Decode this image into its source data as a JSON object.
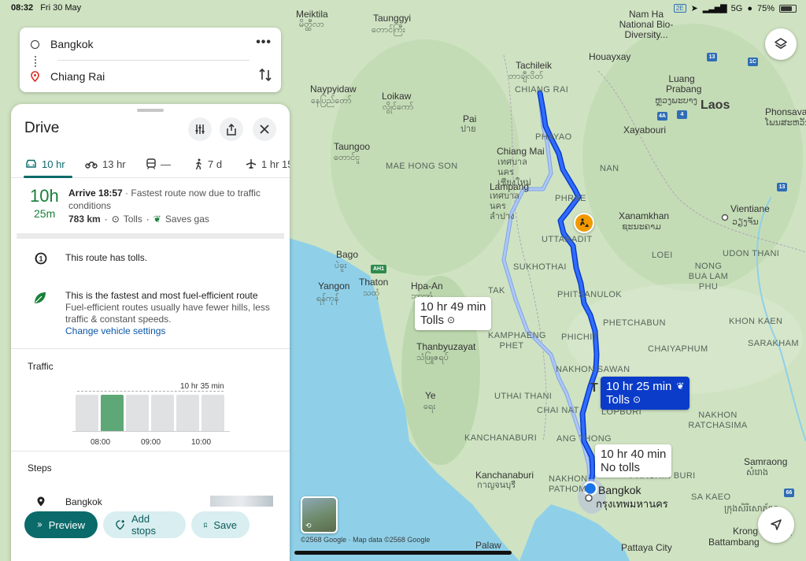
{
  "status_bar": {
    "time": "08:32",
    "date": "Fri 30 May",
    "badge": "2E",
    "network": "5G",
    "battery": "75%",
    "battery_level": 0.75
  },
  "search": {
    "origin": "Bangkok",
    "destination": "Chiang Rai"
  },
  "sheet": {
    "title": "Drive",
    "modes": [
      {
        "label": "10 hr"
      },
      {
        "label": "13 hr"
      },
      {
        "label": "—"
      },
      {
        "label": "7 d"
      },
      {
        "label": "1 hr 15"
      }
    ],
    "summary": {
      "duration_hours": "10h",
      "duration_minutes": "25m",
      "arrive": "Arrive 18:57",
      "reason": " · Fastest route now due to traffic conditions",
      "distance": "783 km",
      "tolls": "Tolls",
      "saves_gas": "Saves gas"
    },
    "tolls_info": "This route has tolls.",
    "eco_info": {
      "title": "This is the fastest and most fuel-efficient route",
      "body": "Fuel-efficient routes usually have fewer hills, less traffic & constant speeds.",
      "link": "Change vehicle settings"
    },
    "traffic": {
      "label": "Traffic",
      "annotation": "10 hr 35 min",
      "ticks": [
        "08:00",
        "09:00",
        "10:00"
      ]
    },
    "steps": {
      "label": "Steps",
      "first": "Bangkok"
    },
    "buttons": {
      "preview": "Preview",
      "add_stops": "Add stops",
      "save": "Save"
    }
  },
  "map": {
    "routes": [
      {
        "line1": "10 hr 49 min",
        "line2": "Tolls"
      },
      {
        "line1": "10 hr 25 min",
        "line2": "Tolls"
      },
      {
        "line1": "10 hr 40 min",
        "line2": "No tolls"
      }
    ],
    "labels": {
      "meiktila": "Meiktila",
      "taunggyi": "Taunggyi",
      "naypyidaw": "Naypyidaw",
      "loikaw": "Loikaw",
      "pai": "Pai",
      "chiangmai": "Chiang Mai",
      "maehongson": "MAE HONG SON",
      "taungoo": "Taungoo",
      "lampang": "Lampang",
      "chiangrai": "CHIANG RAI",
      "phayao": "PHAYAO",
      "tachileik": "Tachileik",
      "houayxay": "Houayxay",
      "namha": "Nam Ha National Bio-Diversity...",
      "luang": "Luang Prabang",
      "laos": "Laos",
      "xayabouri": "Xayabouri",
      "phonsavan": "Phonsavan",
      "vientiane": "Vientiane",
      "nan": "NAN",
      "phrae": "PHRAE",
      "uttaradit": "UTTARADIT",
      "xanamkhan": "Xanamkhan",
      "loei": "LOEI",
      "udonthani": "UDON THANI",
      "nongbua": "NONG BUA LAM PHU",
      "sukhothai": "SUKHOTHAI",
      "tak": "TAK",
      "phitsanulok": "PHITSANULOK",
      "bago": "Bago",
      "thaton": "Thaton",
      "yangon": "Yangon",
      "hpaan": "Hpa-An",
      "phetchabun": "PHETCHABUN",
      "kamphaeng": "KAMPHAENG PHET",
      "phichit": "PHICHIT",
      "khonkaen": "KHON KAEN",
      "chaiyaphum": "CHAIYAPHUM",
      "thanbyu": "Thanbyuzayat",
      "nakhonsawan": "NAKHON SAWAN",
      "uthai": "UTHAI THANI",
      "chainat": "CHAI NAT",
      "lopburi": "LOPBURI",
      "ye": "Ye",
      "nakhonratchasima": "NAKHON RATCHASIMA",
      "kanchanaburi": "KANCHANABURI",
      "angthong": "ANG THONG",
      "kanchanaburi_city": "Kanchanaburi",
      "samrong": "Samraong",
      "nakhonpathom": "NAKHON PATHOM",
      "prachinburi": "PRACHIN BURI",
      "sakaeo": "SA KAEO",
      "bangkok": "Bangkok",
      "pattaya": "Pattaya City",
      "battambang": "Battambang",
      "krong": "Krong",
      "palaw": "Palaw",
      "sarakham": "SARAKHAM",
      "bangkok_thai": "กรุงเทพมหานคร",
      "chiangmai_thai": "เทศบาลนคร เชียงใหม่",
      "lampang_thai": "เทศบาล นครลำปาง",
      "t_label": "T"
    },
    "copyright": "©2568 Google · Map data ©2568 Google"
  }
}
